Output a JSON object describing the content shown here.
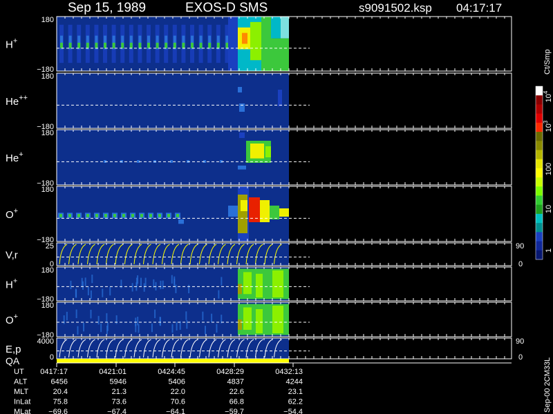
{
  "header": {
    "date": "Sep 15, 1989",
    "instrument": "EXOS-D SMS",
    "file": "s9091502.ksp",
    "time": "04:17:17"
  },
  "chart_data": {
    "type": "heatmap",
    "panels": [
      {
        "label": "H",
        "sup": "+",
        "ytop": "180",
        "ybot": "−180"
      },
      {
        "label": "He",
        "sup": "++",
        "ytop": "180",
        "ybot": "−180"
      },
      {
        "label": "He",
        "sup": "+",
        "ytop": "180",
        "ybot": "−180"
      },
      {
        "label": "O",
        "sup": "+",
        "ytop": "180",
        "ybot": "−180"
      },
      {
        "label": "V,r",
        "sup": "",
        "ytop": "25",
        "ybot": "0",
        "rtop": "90",
        "rbot": "0"
      },
      {
        "label": "H",
        "sup": "+",
        "ytop": "180",
        "ybot": "−180"
      },
      {
        "label": "O",
        "sup": "+",
        "ytop": "180",
        "ybot": "−180"
      },
      {
        "label": "E,p",
        "sup": "",
        "ytop": "4000",
        "ybot": "0",
        "rtop": "90",
        "rbot": "0"
      }
    ],
    "qa_label": "QA",
    "colorbar": {
      "unit": "Ct/Smp",
      "ticks": [
        {
          "text": "10",
          "sup": "4"
        },
        {
          "text": "10",
          "sup": "3"
        },
        {
          "text": "100",
          "sup": ""
        },
        {
          "text": "10",
          "sup": ""
        },
        {
          "text": "1",
          "sup": ""
        }
      ],
      "colors": [
        "#ffffff",
        "#8b0000",
        "#b00000",
        "#e00000",
        "#ff2a00",
        "#6b6b00",
        "#8a8a00",
        "#b5b500",
        "#e6e600",
        "#ffff00",
        "#c8ff00",
        "#7cfc00",
        "#32cd32",
        "#1ea01e",
        "#00c0c0",
        "#009090",
        "#1a40c0",
        "#10289a",
        "#081870"
      ]
    },
    "orbit_table": {
      "rows": [
        {
          "label": "UT",
          "values": [
            "0417:17",
            "0421:01",
            "0424:45",
            "0428:29",
            "0432:13"
          ]
        },
        {
          "label": "ALT",
          "values": [
            "6456",
            "5946",
            "5406",
            "4837",
            "4244"
          ]
        },
        {
          "label": "MLT",
          "values": [
            "20.4",
            "21.3",
            "22.0",
            "22.6",
            "23.1"
          ]
        },
        {
          "label": "InLat",
          "values": [
            "75.8",
            "73.6",
            "70.6",
            "66.8",
            "62.2"
          ]
        },
        {
          "label": "MLat",
          "values": [
            "−69.6",
            "−67.4",
            "−64.1",
            "−59.7",
            "−54.4"
          ]
        }
      ]
    },
    "footer_note": "Sep-00 2CM33L"
  }
}
